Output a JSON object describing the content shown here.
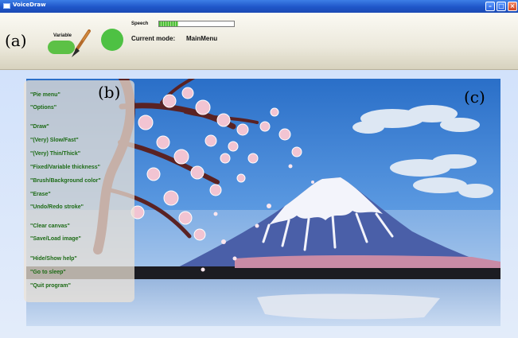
{
  "window": {
    "title": "VoiceDraw"
  },
  "toolbar": {
    "panel_label": "(a)",
    "thickness_label": "Variable",
    "speech_label": "Speech",
    "speech_level": 0.25,
    "mode_caption": "Current mode:",
    "mode_value": "MainMenu",
    "colors": {
      "toggle": "#5cc146",
      "indicator": "#4ec143"
    }
  },
  "help": {
    "panel_label": "(b)",
    "commands": [
      "\"Pie menu\"",
      "\"Options\"",
      "\"Draw\"",
      "\"(Very) Slow/Fast\"",
      "\"(Very) Thin/Thick\"",
      "\"Fixed/Variable thickness\"",
      "\"Brush/Background color\"",
      "\"Erase\"",
      "\"Undo/Redo stroke\"",
      "\"Clear canvas\"",
      "\"Save/Load image\"",
      "\"Hide/Show help\"",
      "\"Go to sleep\"",
      "\"Quit program\""
    ],
    "text_color": "#1d6b16"
  },
  "canvas": {
    "panel_label": "(c)",
    "scene": "painting of Mount Fuji with cherry blossoms",
    "colors": {
      "sky": "#2a71c8",
      "mountain": "#4a5fa8",
      "snow": "#f3f4fb",
      "blossom": "#f2c4d2",
      "branch": "#5a2223"
    }
  }
}
